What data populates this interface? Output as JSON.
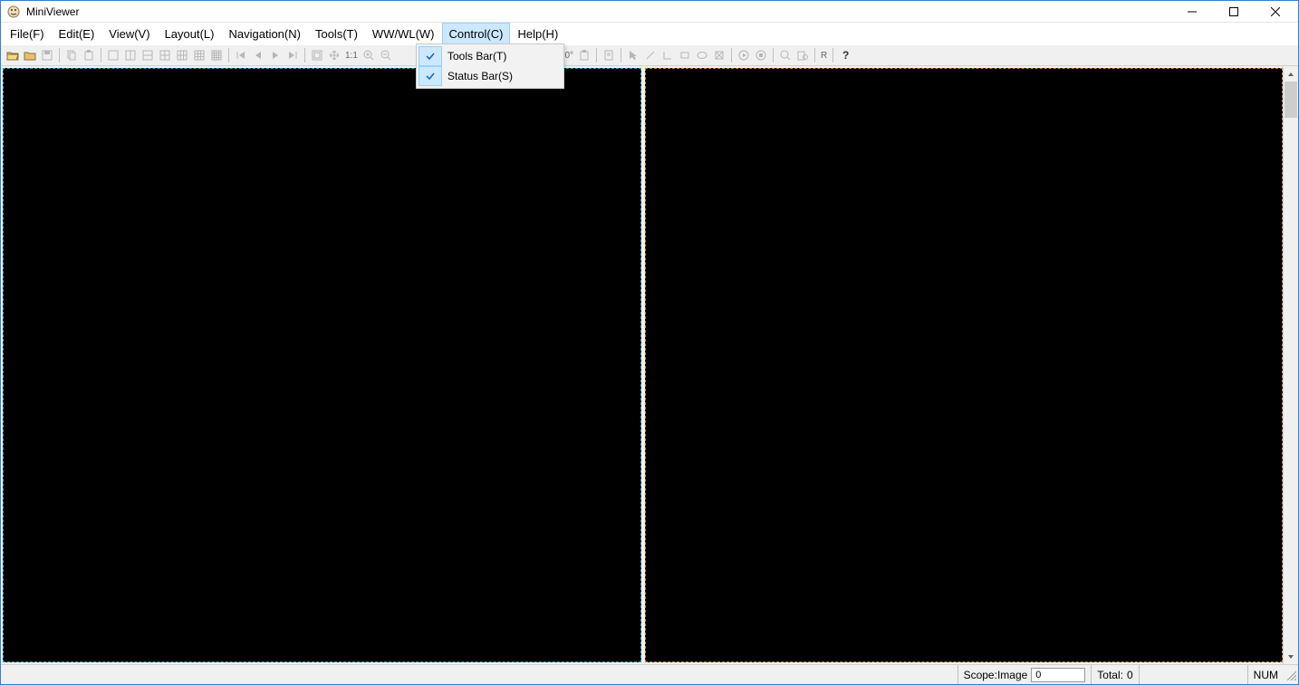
{
  "window": {
    "title": "MiniViewer"
  },
  "menu": {
    "items": [
      {
        "label": "File(F)"
      },
      {
        "label": "Edit(E)"
      },
      {
        "label": "View(V)"
      },
      {
        "label": "Layout(L)"
      },
      {
        "label": "Navigation(N)"
      },
      {
        "label": "Tools(T)"
      },
      {
        "label": "WW/WL(W)"
      },
      {
        "label": "Control(C)",
        "active": true
      },
      {
        "label": "Help(H)"
      }
    ]
  },
  "control_menu": {
    "items": [
      {
        "label": "Tools Bar(T)",
        "checked": true
      },
      {
        "label": "Status Bar(S)",
        "checked": true
      }
    ]
  },
  "toolbar": {
    "ratio_label": "1:1",
    "rotate_label": "90°",
    "reset_label": "R"
  },
  "status": {
    "scope_label": "Scope:Image",
    "scope_value": "0",
    "total_label": "Total:",
    "total_value": "0",
    "num_label": "NUM"
  }
}
